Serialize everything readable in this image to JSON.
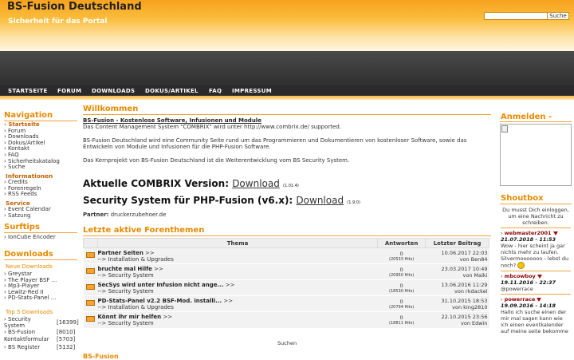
{
  "header": {
    "title": "BS-Fusion Deutschland",
    "subtitle": "Sicherheit für das Portal",
    "search_button": "Suche"
  },
  "nav": [
    "STARTSEITE",
    "FORUM",
    "DOWNLOADS",
    "DOKUS/ARTIKEL",
    "FAQ",
    "IMPRESSUM"
  ],
  "left": {
    "nav_title": "Navigation",
    "nav_items": [
      "Startseite",
      "Forum",
      "Downloads",
      "Dokus/Artikel",
      "Kontakt",
      "FAQ",
      "Sicherheitskatalog",
      "Suche"
    ],
    "info_title": "Informationen",
    "info_items": [
      "Credits",
      "Forenregeln",
      "RSS Feeds"
    ],
    "service_title": "Service",
    "service_items": [
      "Event Calendar",
      "Satzung"
    ],
    "surftips_title": "Surftips",
    "surftips_items": [
      "IonCube Encoder"
    ],
    "downloads_title": "Downloads",
    "new_downloads_title": "Neue Downloads",
    "new_downloads": [
      "Greystar",
      "The Player BSF ...",
      "Mp3-Player",
      "Lewitz-Red II",
      "PD-Stats-Panel ..."
    ],
    "top_downloads_title": "Top 5 Downloads",
    "top_downloads": [
      {
        "name": "Security System",
        "count": "[16399]"
      },
      {
        "name": "BS-Fusion",
        "count": "[8010]"
      },
      {
        "name": "Kontaktformular",
        "count": "[5703]"
      },
      {
        "name": "BS Register",
        "count": "[5132]"
      }
    ]
  },
  "main": {
    "title": "Willkommen",
    "headline": "BS-Fusion - Kostenlose Software, Infusionen und Module",
    "line1": "Das Content Management System \"COMBRIX\" wird unter http://www.combrix.de/ supported.",
    "line2": "BS-Fusion Deutschland wird eine Community Seite rund um das Programmieren und Dokumentieren von kostenloser Software, sowie das Entwickeln von Module und Infusionen für die PHP-Fusion Software.",
    "line3": "Das Kernprojekt von BS-Fusion Deutschland ist die Weiterentwicklung vom BS Security System.",
    "combrix_label": "Aktuelle COMBRIX Version:",
    "combrix_link": "Download",
    "combrix_version": "(1.01.4)",
    "security_label": "Security System für PHP-Fusion (v6.x):",
    "security_link": "Download",
    "security_version": "(1.9.0)",
    "partner_label": "Partner:",
    "partner_value": "druckerzubehoer.de",
    "forum_title": "Letzte aktive Forenthemen",
    "forum_headers": [
      "Thema",
      "Antworten",
      "Letzter Beitrag"
    ],
    "forum_rows": [
      {
        "title": "Partner Seiten",
        "cat": "--> Installation & Upgrades",
        "answers": "0",
        "hits": "(20533 Hits)",
        "date": "10.06.2017 22:03",
        "by": "von Ben84"
      },
      {
        "title": "bruchte mal Hilfe",
        "cat": "--> Security System",
        "answers": "0",
        "hits": "(20950 Hits)",
        "date": "23.03.2017 10:49",
        "by": "von Maiki"
      },
      {
        "title": "SecSys wird unter Infusion nicht ange...",
        "cat": "--> Security System",
        "answers": "0",
        "hits": "(18530 Hits)",
        "date": "13.06.2016 11:29",
        "by": "von rkdackel"
      },
      {
        "title": "PD-Stats-Panel v2.2 BSF-Mod. installi...",
        "cat": "--> Installation & Upgrades",
        "answers": "0",
        "hits": "(20794 Hits)",
        "date": "31.10.2015 18:53",
        "by": "von king2810"
      },
      {
        "title": "Könnt ihr mir helfen",
        "cat": "--> Security System",
        "answers": "0",
        "hits": "(18811 Hits)",
        "date": "22.10.2015 23:56",
        "by": "von Edwin"
      }
    ],
    "search_link": "Suchen",
    "tail": "BS-Fusion"
  },
  "right": {
    "login_title": "Anmelden",
    "shoutbox_title": "Shoutbox",
    "shout_intro": "Du musst Dich einloggen, um eine Nachricht zu schreiben.",
    "shouts": [
      {
        "user": "webmaster2001",
        "date": "21.07.2018 - 11:53",
        "text": "Wow - hier scheint ja gar nichts mehr zu laufen. Silvermoooooon - lebst du noch?"
      },
      {
        "user": "mbcowboy",
        "date": "19.11.2016 - 22:37",
        "text": "@powerrace"
      },
      {
        "user": "powerrace",
        "date": "19.09.2016 - 14:18",
        "text": "Hallo ich suche einen der mir mal sagen kann wie ich einen eventkalender auf meine seite bekomme"
      }
    ]
  }
}
